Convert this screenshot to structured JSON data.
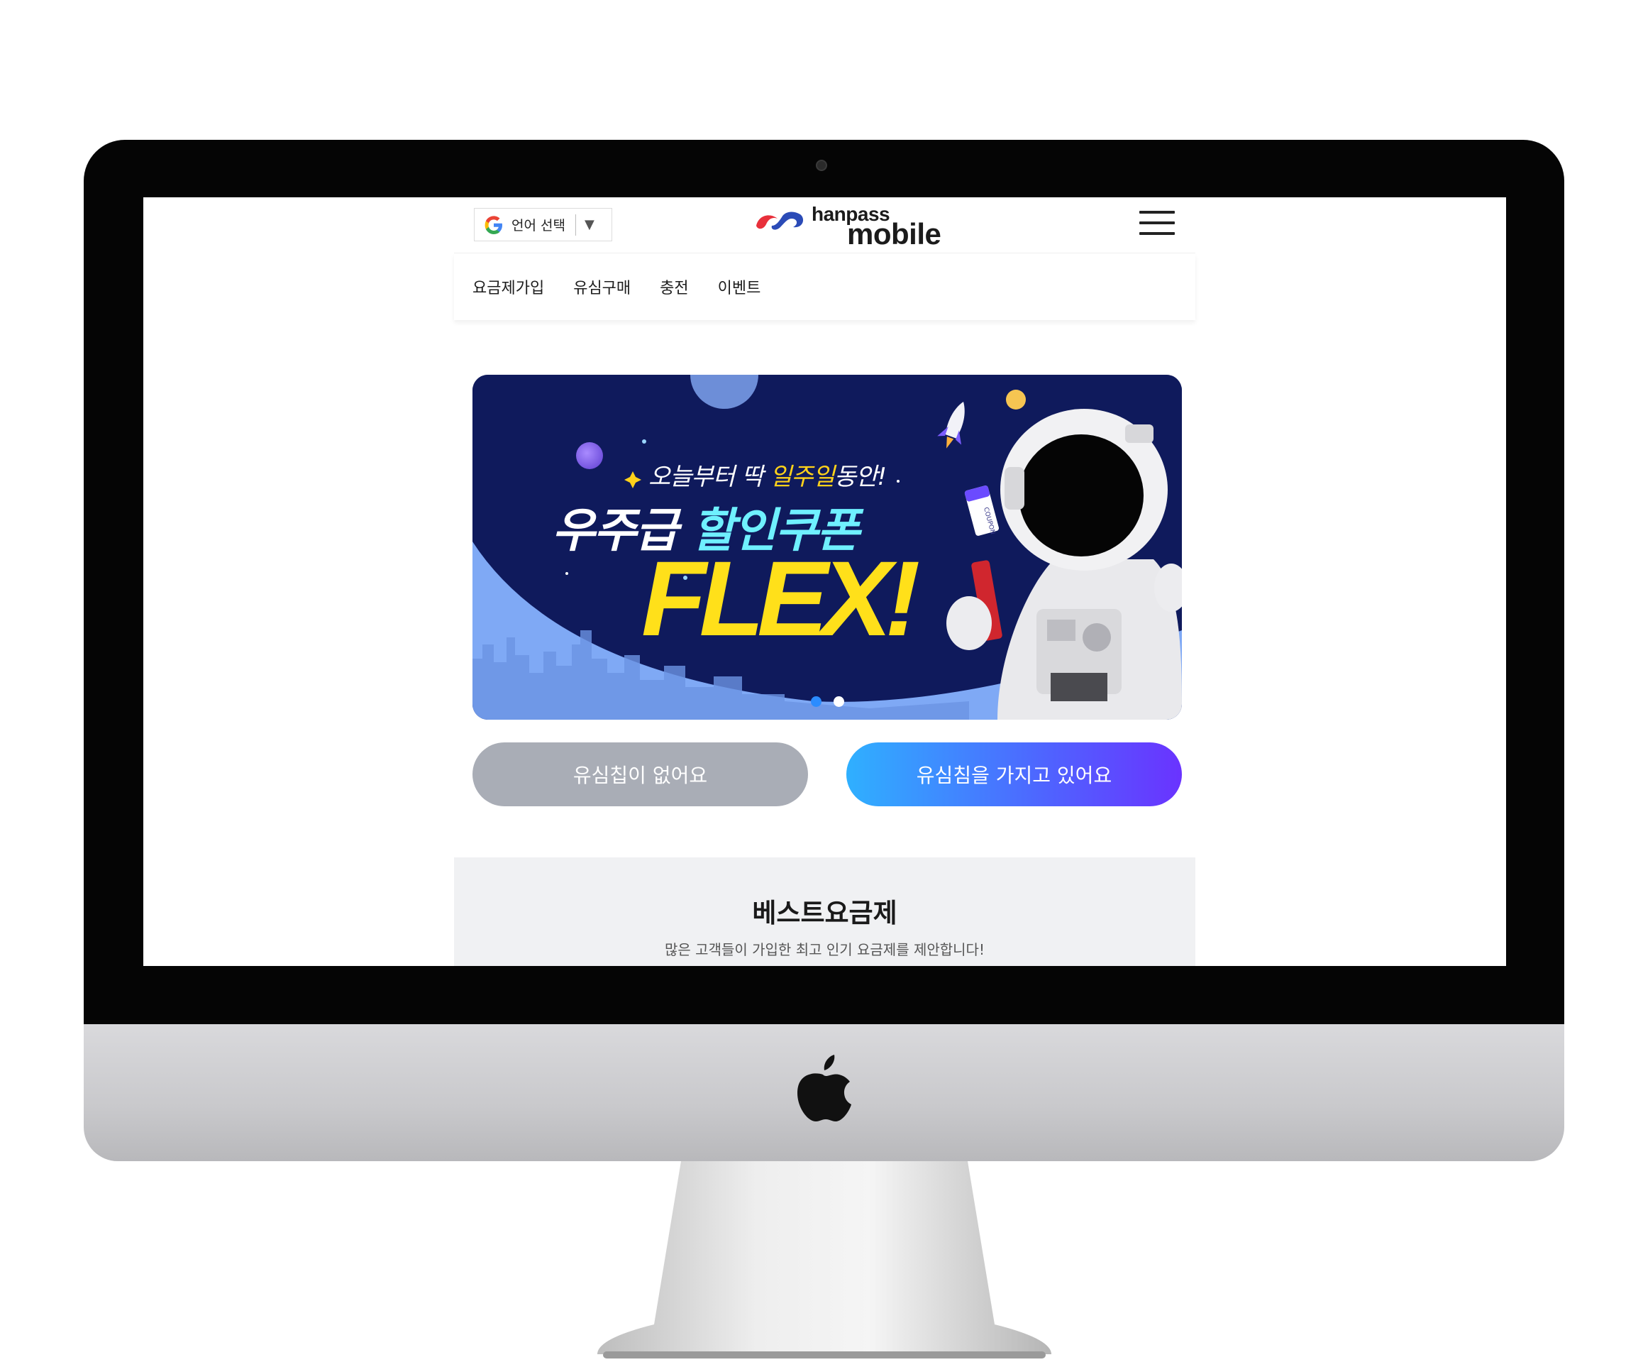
{
  "header": {
    "language_select": {
      "label": "언어 선택",
      "arrow": "▼",
      "icon": "google-g-icon"
    },
    "logo": {
      "line1": "hanpass",
      "line2": "mobile"
    },
    "menu_icon": "hamburger-menu-icon"
  },
  "nav": {
    "items": [
      {
        "label": "요금제가입"
      },
      {
        "label": "유심구매"
      },
      {
        "label": "충전"
      },
      {
        "label": "이벤트"
      }
    ]
  },
  "banner": {
    "subtitle_pre": "오늘부터 딱 ",
    "subtitle_highlight": "일주일",
    "subtitle_post": "동안!",
    "title_white": "우주급 ",
    "title_cyan": "할인쿠폰",
    "flex": "FLEX!",
    "coupon_label": "COUPON",
    "slide_count": 2,
    "active_slide": 1
  },
  "buttons": {
    "no_sim": "유심칩이 없어요",
    "have_sim": "유심침을 가지고 있어요"
  },
  "best": {
    "title": "베스트요금제",
    "description": "많은 고객들이 가입한 최고 인기 요금제를 제안합니다!"
  },
  "colors": {
    "accent_gradient_start": "#2fb0ff",
    "accent_gradient_end": "#6a33ff",
    "gray_button": "#a9adb6",
    "banner_navy": "#0f1a5c",
    "flex_yellow": "#ffe01a"
  }
}
